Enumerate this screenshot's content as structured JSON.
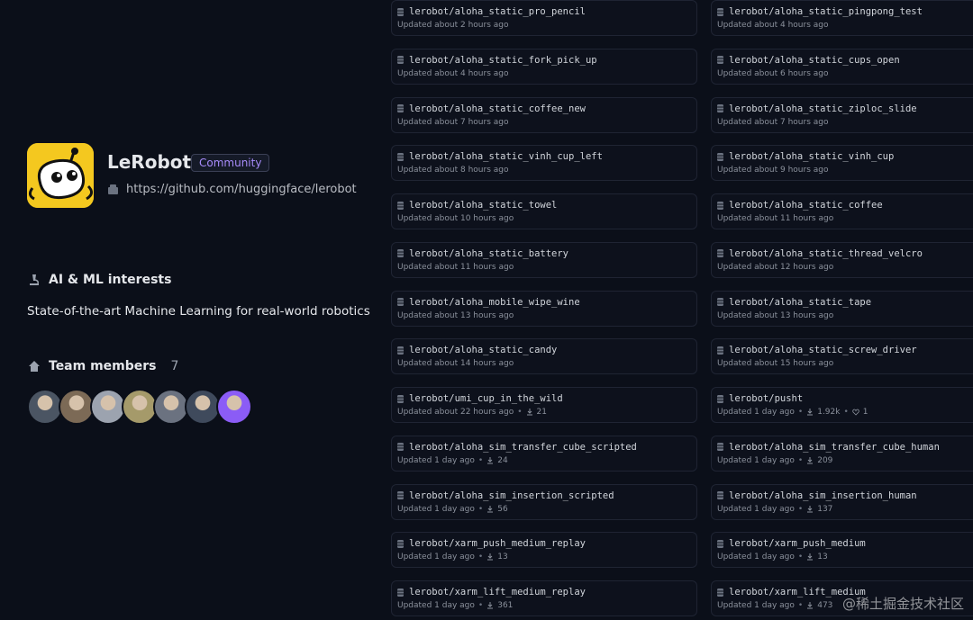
{
  "org": {
    "name": "LeRobot",
    "badge": "Community",
    "github_url": "https://github.com/huggingface/lerobot"
  },
  "interests": {
    "title": "AI & ML interests",
    "text": "State-of-the-art Machine Learning for real-world robotics"
  },
  "team": {
    "title": "Team members",
    "count": "7",
    "avatar_colors": [
      "#4b5563",
      "#7c6a56",
      "#9ca3af",
      "#a59a6a",
      "#6b7280",
      "#3f4a5c",
      "#8b5cf6"
    ]
  },
  "datasets": {
    "left": [
      {
        "name": "lerobot/aloha_static_pro_pencil",
        "updated": "Updated about 2 hours ago"
      },
      {
        "name": "lerobot/aloha_static_fork_pick_up",
        "updated": "Updated about 4 hours ago"
      },
      {
        "name": "lerobot/aloha_static_coffee_new",
        "updated": "Updated about 7 hours ago"
      },
      {
        "name": "lerobot/aloha_static_vinh_cup_left",
        "updated": "Updated about 8 hours ago"
      },
      {
        "name": "lerobot/aloha_static_towel",
        "updated": "Updated about 10 hours ago"
      },
      {
        "name": "lerobot/aloha_static_battery",
        "updated": "Updated about 11 hours ago"
      },
      {
        "name": "lerobot/aloha_mobile_wipe_wine",
        "updated": "Updated about 13 hours ago"
      },
      {
        "name": "lerobot/aloha_static_candy",
        "updated": "Updated about 14 hours ago"
      },
      {
        "name": "lerobot/umi_cup_in_the_wild",
        "updated": "Updated about 22 hours ago",
        "downloads": "21"
      },
      {
        "name": "lerobot/aloha_sim_transfer_cube_scripted",
        "updated": "Updated 1 day ago",
        "downloads": "24"
      },
      {
        "name": "lerobot/aloha_sim_insertion_scripted",
        "updated": "Updated 1 day ago",
        "downloads": "56"
      },
      {
        "name": "lerobot/xarm_push_medium_replay",
        "updated": "Updated 1 day ago",
        "downloads": "13"
      },
      {
        "name": "lerobot/xarm_lift_medium_replay",
        "updated": "Updated 1 day ago",
        "downloads": "361"
      }
    ],
    "right": [
      {
        "name": "lerobot/aloha_static_pingpong_test",
        "updated": "Updated about 4 hours ago"
      },
      {
        "name": "lerobot/aloha_static_cups_open",
        "updated": "Updated about 6 hours ago"
      },
      {
        "name": "lerobot/aloha_static_ziploc_slide",
        "updated": "Updated about 7 hours ago"
      },
      {
        "name": "lerobot/aloha_static_vinh_cup",
        "updated": "Updated about 9 hours ago"
      },
      {
        "name": "lerobot/aloha_static_coffee",
        "updated": "Updated about 11 hours ago"
      },
      {
        "name": "lerobot/aloha_static_thread_velcro",
        "updated": "Updated about 12 hours ago"
      },
      {
        "name": "lerobot/aloha_static_tape",
        "updated": "Updated about 13 hours ago"
      },
      {
        "name": "lerobot/aloha_static_screw_driver",
        "updated": "Updated about 15 hours ago"
      },
      {
        "name": "lerobot/pusht",
        "updated": "Updated 1 day ago",
        "downloads": "1.92k",
        "likes": "1"
      },
      {
        "name": "lerobot/aloha_sim_transfer_cube_human",
        "updated": "Updated 1 day ago",
        "downloads": "209"
      },
      {
        "name": "lerobot/aloha_sim_insertion_human",
        "updated": "Updated 1 day ago",
        "downloads": "137"
      },
      {
        "name": "lerobot/xarm_push_medium",
        "updated": "Updated 1 day ago",
        "downloads": "13"
      },
      {
        "name": "lerobot/xarm_lift_medium",
        "updated": "Updated 1 day ago",
        "downloads": "473"
      }
    ]
  },
  "watermark": "@稀土掘金技术社区",
  "colors": {
    "background": "#0b0f19",
    "accent": "#a78bfa",
    "logo_bg": "#f4c81f"
  }
}
